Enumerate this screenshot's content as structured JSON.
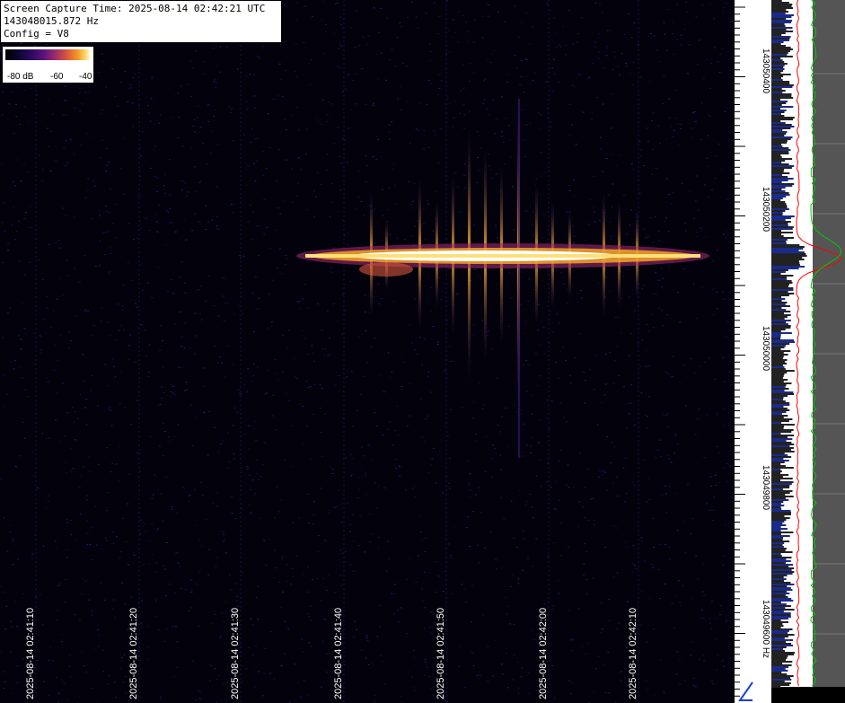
{
  "header": {
    "capture_time": "Screen Capture Time: 2025-08-14 02:42:21 UTC",
    "frequency": "143048015.872 Hz",
    "config": "Config = V8"
  },
  "color_scale": {
    "labels": [
      "-80 dB",
      "-60",
      "-40"
    ]
  },
  "time_axis": {
    "labels": [
      "2025-08-14 02:41:10",
      "2025-08-14 02:41:20",
      "2025-08-14 02:41:30",
      "2025-08-14 02:41:40",
      "2025-08-14 02:41:50",
      "2025-08-14 02:42:00",
      "2025-08-14 02:42:10"
    ]
  },
  "freq_axis": {
    "labels": [
      "143050400",
      "143050200",
      "143050000",
      "143049800",
      "143049600 Hz"
    ]
  },
  "colors": {
    "background": "#03020c",
    "signal_core": "#ffffff",
    "signal_glow": "#f5a623",
    "trace_green": "#00cc00",
    "trace_red": "#ff0000",
    "trace_gray": "#555555"
  }
}
